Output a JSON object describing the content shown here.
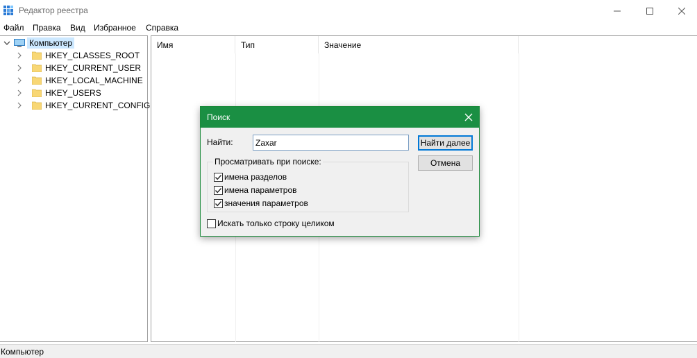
{
  "window": {
    "title": "Редактор реестра"
  },
  "menu": [
    "Файл",
    "Правка",
    "Вид",
    "Избранное",
    "Справка"
  ],
  "tree": {
    "root": "Компьютер",
    "children": [
      "HKEY_CLASSES_ROOT",
      "HKEY_CURRENT_USER",
      "HKEY_LOCAL_MACHINE",
      "HKEY_USERS",
      "HKEY_CURRENT_CONFIG"
    ]
  },
  "list": {
    "columns": [
      "Имя",
      "Тип",
      "Значение"
    ]
  },
  "status": {
    "path": "Компьютер"
  },
  "dialog": {
    "title": "Поиск",
    "find_label": "Найти:",
    "find_value": "Zaxar",
    "find_next": "Найти далее",
    "cancel": "Отмена",
    "group_title": "Просматривать при поиске:",
    "options": [
      {
        "label": "имена разделов",
        "checked": true
      },
      {
        "label": "имена параметров",
        "checked": true
      },
      {
        "label": "значения параметров",
        "checked": true
      }
    ],
    "whole_string": {
      "label": "Искать только строку целиком",
      "checked": false
    }
  },
  "colors": {
    "dialog_title_bg": "#1a8f43",
    "selection_bg": "#cce8ff",
    "button_focus_border": "#0078d7"
  }
}
